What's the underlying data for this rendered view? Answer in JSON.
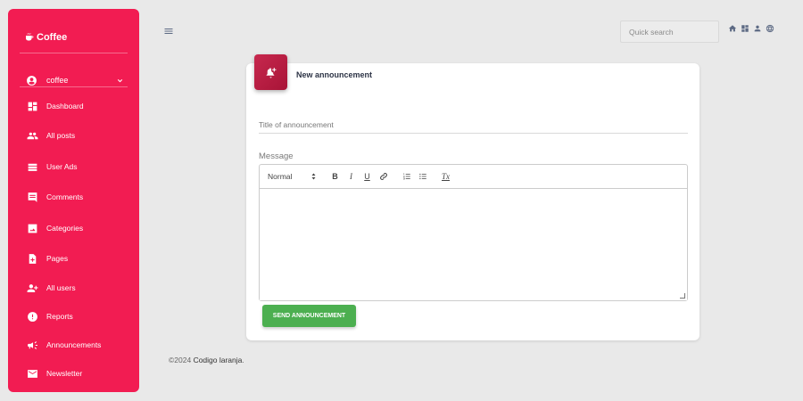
{
  "sidebar": {
    "brand": "Coffee",
    "user": {
      "name": "coffee"
    },
    "items": [
      {
        "label": "Dashboard",
        "icon": "dashboard-icon"
      },
      {
        "label": "All posts",
        "icon": "people-icon"
      },
      {
        "label": "User Ads",
        "icon": "list-icon"
      },
      {
        "label": "Comments",
        "icon": "comment-icon"
      },
      {
        "label": "Categories",
        "icon": "image-icon"
      },
      {
        "label": "Pages",
        "icon": "document-add-icon"
      },
      {
        "label": "All users",
        "icon": "person-add-icon"
      },
      {
        "label": "Reports",
        "icon": "alert-icon"
      },
      {
        "label": "Announcements",
        "icon": "megaphone-icon"
      },
      {
        "label": "Newsletter",
        "icon": "mail-icon"
      }
    ]
  },
  "topbar": {
    "search_placeholder": "Quick search",
    "icons": [
      "home-icon",
      "dashboard-icon",
      "person-icon",
      "globe-icon"
    ]
  },
  "card": {
    "title": "New announcement",
    "title_placeholder": "Title of announcement",
    "message_label": "Message",
    "toolbar": {
      "format": "Normal",
      "bold": "B",
      "italic": "I",
      "underline": "U",
      "clear": "Tx"
    },
    "send_label": "SEND ANNOUNCEMENT"
  },
  "footer": {
    "copyright": "©2024",
    "brand": "Codigo laranja",
    "suffix": "."
  },
  "colors": {
    "sidebar": "#f21c52",
    "accent": "#b51a3f",
    "success": "#4caf50"
  }
}
